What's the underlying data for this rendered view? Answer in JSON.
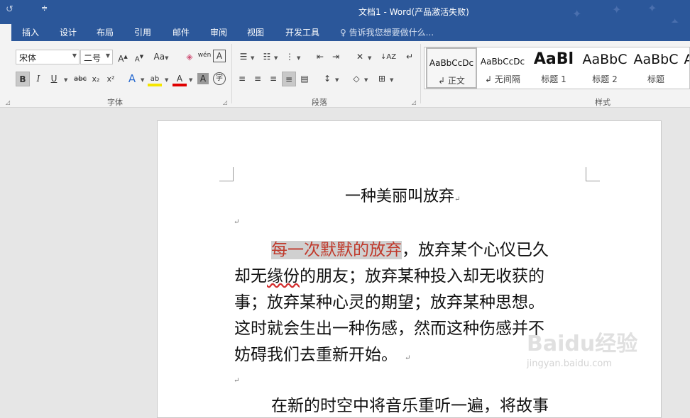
{
  "window": {
    "title": "文档1 - Word(产品激活失败)",
    "qat_undo": "↺",
    "qat_customize": "≑"
  },
  "tabs": [
    "插入",
    "设计",
    "布局",
    "引用",
    "邮件",
    "审阅",
    "视图",
    "开发工具"
  ],
  "tell_me": "告诉我您想要做什么...",
  "font_group": {
    "label": "字体",
    "font_name": "宋体",
    "font_size": "二号",
    "grow": "A",
    "shrink": "A",
    "change_case": "Aa",
    "phonetic": "wén",
    "border_char": "A",
    "bold": "B",
    "italic": "I",
    "underline": "U",
    "strike": "abc",
    "subscript": "x₂",
    "superscript": "x²",
    "text_effects": "A",
    "font_color": "A",
    "shading": "A",
    "enclose": "字"
  },
  "paragraph_group": {
    "label": "段落"
  },
  "styles_group": {
    "label": "样式",
    "items": [
      {
        "sample": "AaBbCcDc",
        "name": "正文"
      },
      {
        "sample": "AaBbCcDc",
        "name": "无间隔"
      },
      {
        "sample": "AaBl",
        "name": "标题 1"
      },
      {
        "sample": "AaBbC",
        "name": "标题 2"
      },
      {
        "sample": "AaBbC",
        "name": "标题"
      },
      {
        "sample": "A",
        "name": ""
      }
    ]
  },
  "document": {
    "title": "一种美丽叫放弃",
    "para1_highlight": "每一次默默的放弃",
    "para1_line1_rest": "，放弃某个心仪已久",
    "para1_line2_a": "却无",
    "para1_line2_wavy": "缘份",
    "para1_line2_b": "的朋友；放弃某种投入却无收获的",
    "para1_line3": "事；放弃某种心灵的期望；放弃某种思想。",
    "para1_line4": "这时就会生出一种伤感，然而这种伤感并不",
    "para1_line5": "妨碍我们去重新开始。",
    "para2_partial": "在新的时空中将音乐重听一遍，将故事",
    "para_mark": "↵"
  },
  "watermark": {
    "brand": "Baidu经验",
    "url": "jingyan.baidu.com"
  },
  "colors": {
    "ribbon_blue": "#2b579a",
    "highlight_text": "#c0392b",
    "highlight_bg": "#d0d0d0"
  }
}
